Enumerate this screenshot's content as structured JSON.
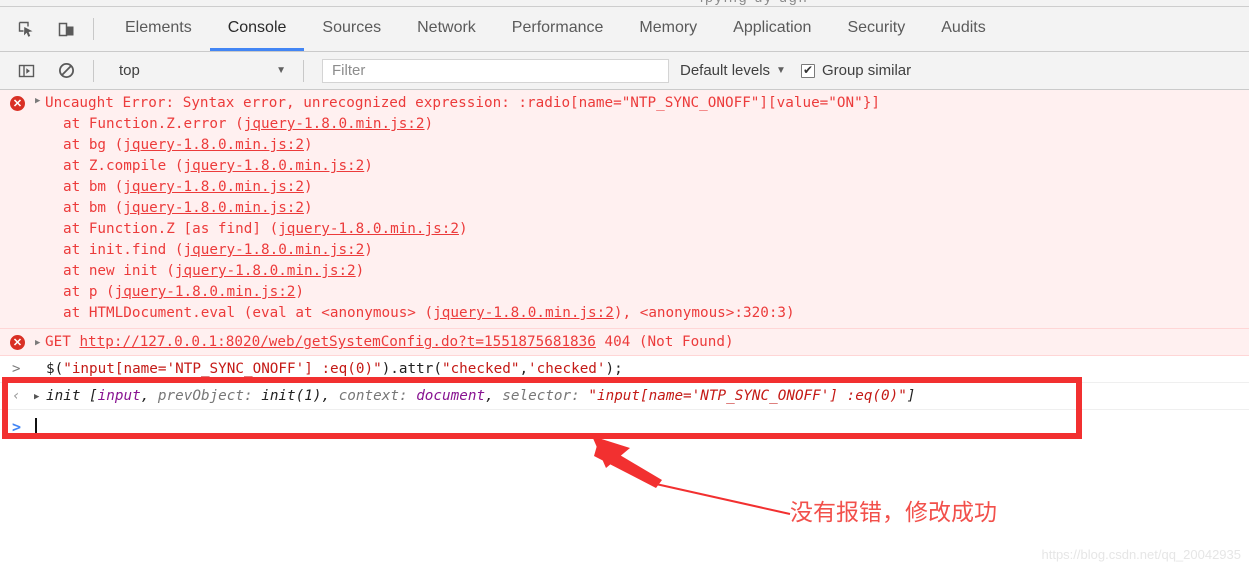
{
  "toolbar": {
    "icons": [
      {
        "name": "inspect-element-icon",
        "title": "Inspect element"
      },
      {
        "name": "device-toolbar-icon",
        "title": "Toggle device toolbar"
      }
    ],
    "tabs": [
      {
        "label": "Elements",
        "active": false
      },
      {
        "label": "Console",
        "active": true
      },
      {
        "label": "Sources",
        "active": false
      },
      {
        "label": "Network",
        "active": false
      },
      {
        "label": "Performance",
        "active": false
      },
      {
        "label": "Memory",
        "active": false
      },
      {
        "label": "Application",
        "active": false
      },
      {
        "label": "Security",
        "active": false
      },
      {
        "label": "Audits",
        "active": false
      }
    ]
  },
  "filterbar": {
    "sidebar_icon": "console-sidebar-icon",
    "clear_icon": "clear-console-icon",
    "context": "top",
    "context_caret": "▼",
    "filter_placeholder": "Filter",
    "levels_label": "Default levels",
    "levels_caret": "▼",
    "group_similar_label": "Group similar",
    "group_similar_checked": true
  },
  "console": {
    "error1": {
      "icon_glyph": "✕",
      "message": "Uncaught Error: Syntax error, unrecognized expression: :radio[name=\"NTP_SYNC_ONOFF\"][value=\"ON\"}]",
      "stack": [
        {
          "pre": "at Function.Z.error (",
          "link": "jquery-1.8.0.min.js:2",
          "post": ")"
        },
        {
          "pre": "at bg (",
          "link": "jquery-1.8.0.min.js:2",
          "post": ")"
        },
        {
          "pre": "at Z.compile (",
          "link": "jquery-1.8.0.min.js:2",
          "post": ")"
        },
        {
          "pre": "at bm (",
          "link": "jquery-1.8.0.min.js:2",
          "post": ")"
        },
        {
          "pre": "at bm (",
          "link": "jquery-1.8.0.min.js:2",
          "post": ")"
        },
        {
          "pre": "at Function.Z [as find] (",
          "link": "jquery-1.8.0.min.js:2",
          "post": ")"
        },
        {
          "pre": "at init.find (",
          "link": "jquery-1.8.0.min.js:2",
          "post": ")"
        },
        {
          "pre": "at new init (",
          "link": "jquery-1.8.0.min.js:2",
          "post": ")"
        },
        {
          "pre": "at p (",
          "link": "jquery-1.8.0.min.js:2",
          "post": ")"
        },
        {
          "pre": "at HTMLDocument.eval (eval at <anonymous> (",
          "link": "jquery-1.8.0.min.js:2",
          "post": "), <anonymous>:320:3)"
        }
      ]
    },
    "error2": {
      "icon_glyph": "✕",
      "method": "GET ",
      "url": "http://127.0.0.1:8020/web/getSystemConfig.do?t=1551875681836",
      "status": " 404 (Not Found)"
    },
    "input": {
      "prompt": ">",
      "code_part1": "$(",
      "code_str1": "\"input[name='NTP_SYNC_ONOFF'] :eq(0)\"",
      "code_part2": ").attr(",
      "code_str2": "\"checked\"",
      "code_part3": ",",
      "code_str3": "'checked'",
      "code_part4": ");"
    },
    "result": {
      "prompt": "‹",
      "t1": "init ",
      "t2": "[",
      "t3": "input",
      "t4": ", ",
      "t5": "prevObject",
      "t6": ": ",
      "t7": "init(1)",
      "t8": ", ",
      "t9": "context",
      "t10": ": ",
      "t11": "document",
      "t12": ", ",
      "t13": "selector",
      "t14": ": ",
      "t15": "\"input[name='NTP_SYNC_ONOFF'] :eq(0)\"",
      "t16": "]"
    },
    "empty_prompt": ">"
  },
  "annotation": {
    "note_text": "没有报错，修改成功",
    "arrow_color": "#f23030",
    "box_color": "#f23030"
  },
  "watermark": "https://blog.csdn.net/qq_20042935"
}
